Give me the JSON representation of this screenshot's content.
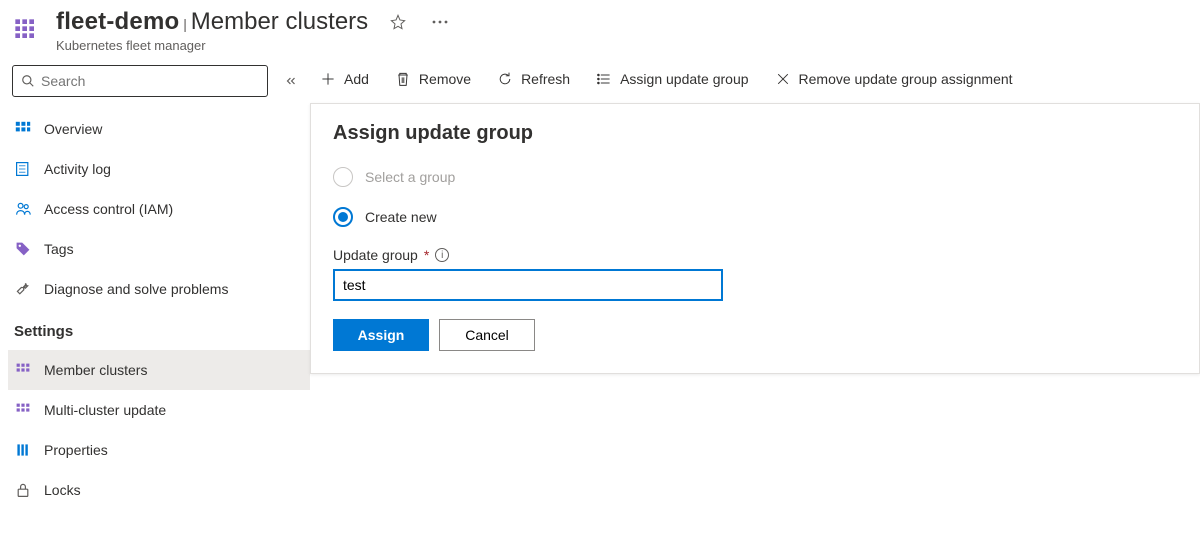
{
  "header": {
    "resource_name": "fleet-demo",
    "page_title": "Member clusters",
    "subtitle": "Kubernetes fleet manager"
  },
  "sidebar": {
    "search_placeholder": "Search",
    "general": {
      "overview": "Overview",
      "activity_log": "Activity log",
      "access_control": "Access control (IAM)",
      "tags": "Tags",
      "diagnose": "Diagnose and solve problems"
    },
    "section_heading": "Settings",
    "settings": {
      "member_clusters": "Member clusters",
      "multi_cluster_update": "Multi-cluster update",
      "properties": "Properties",
      "locks": "Locks"
    }
  },
  "toolbar": {
    "add": "Add",
    "remove": "Remove",
    "refresh": "Refresh",
    "assign_update_group": "Assign update group",
    "remove_update_group": "Remove update group assignment"
  },
  "panel": {
    "title": "Assign update group",
    "radio_select": "Select a group",
    "radio_create": "Create new",
    "field_label": "Update group",
    "input_value": "test",
    "assign_btn": "Assign",
    "cancel_btn": "Cancel"
  }
}
